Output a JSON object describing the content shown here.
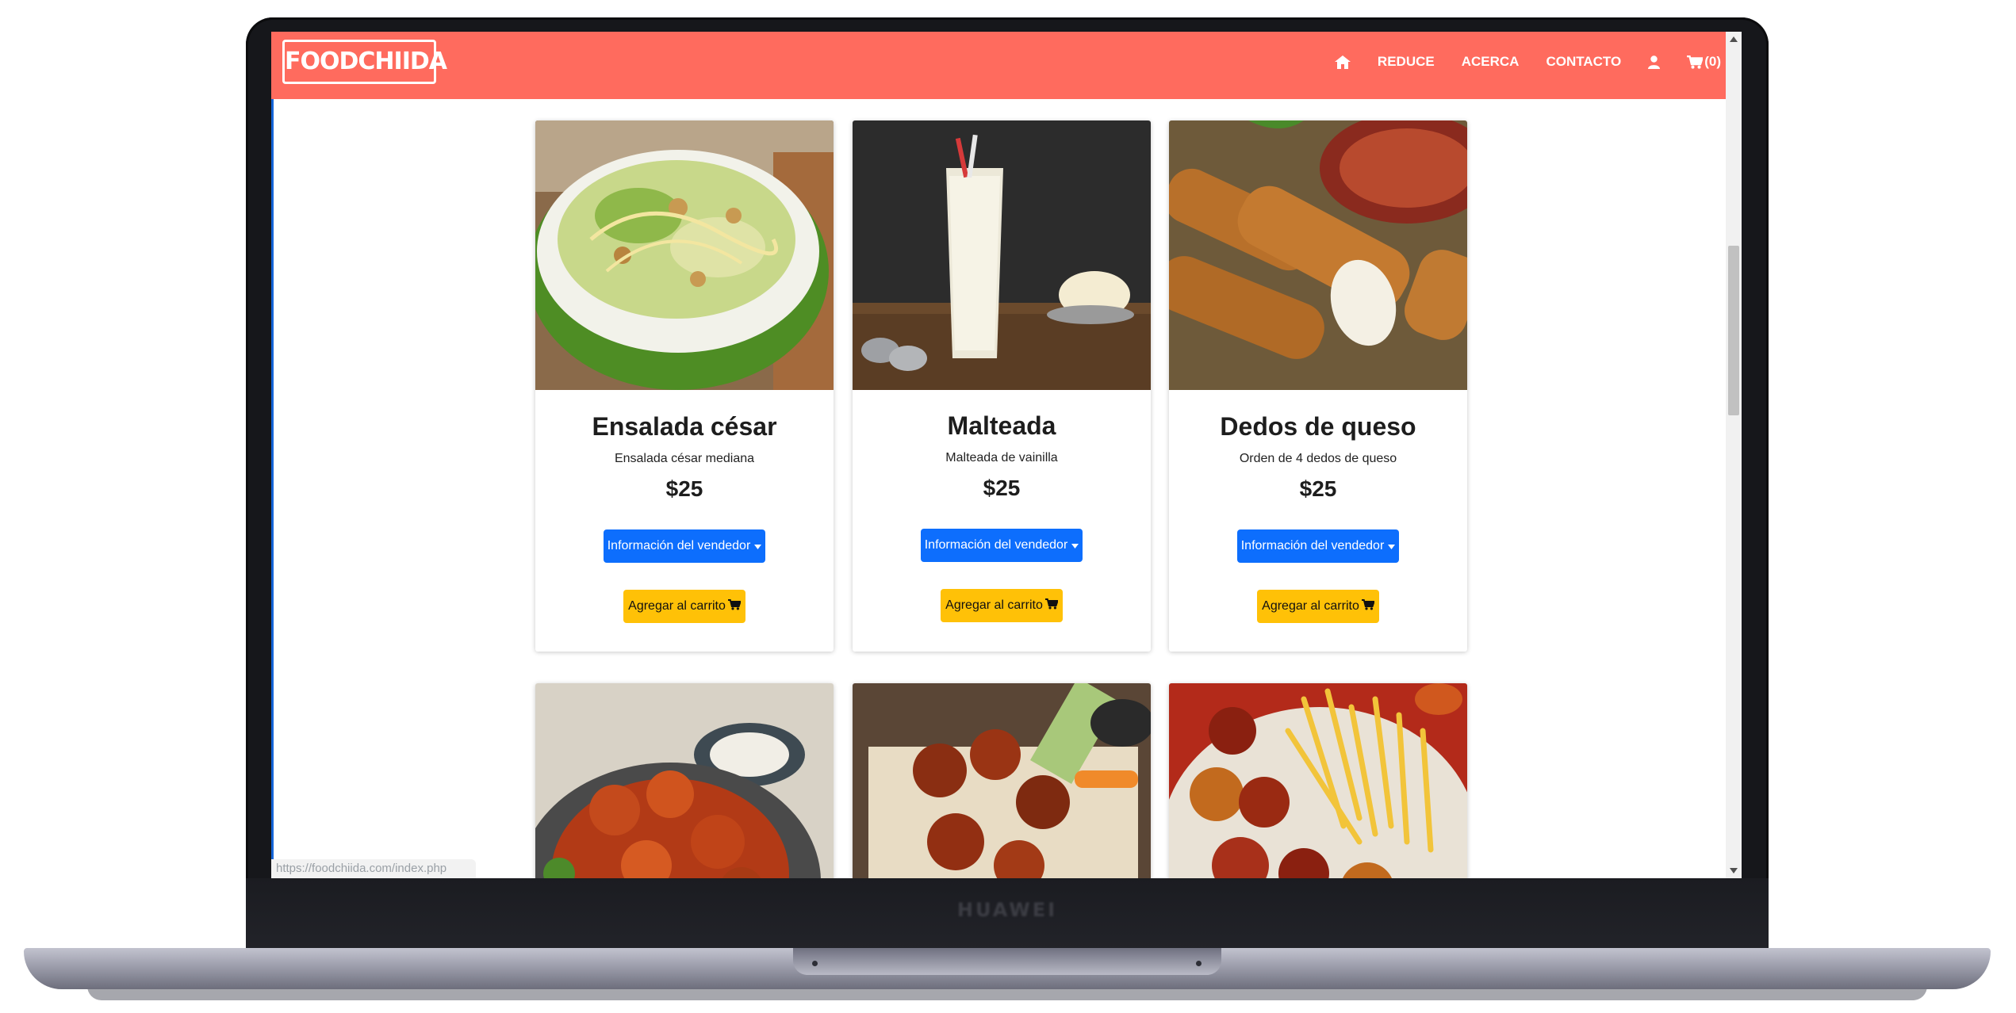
{
  "device": {
    "brand": "HUAWEI"
  },
  "app": {
    "logo_text": "FOODCHIIDA",
    "nav": {
      "home_icon": "home-icon",
      "items": [
        {
          "label": "REDUCE"
        },
        {
          "label": "ACERCA"
        },
        {
          "label": "CONTACTO"
        }
      ],
      "user_icon": "user-icon",
      "cart_icon": "cart-icon",
      "cart_count": "(0)"
    },
    "colors": {
      "navbar": "#ff6b5e",
      "vendor_button": "#0d6efd",
      "cart_button": "#ffc107"
    }
  },
  "products": [
    {
      "title": "Ensalada césar",
      "description": "Ensalada césar mediana",
      "price": "$25",
      "vendor_label": "Información del vendedor",
      "cart_label": "Agregar al carrito"
    },
    {
      "title": "Malteada",
      "description": "Malteada de vainilla",
      "price": "$25",
      "vendor_label": "Información del vendedor",
      "cart_label": "Agregar al carrito"
    },
    {
      "title": "Dedos de queso",
      "description": "Orden de 4 dedos de queso",
      "price": "$25",
      "vendor_label": "Información del vendedor",
      "cart_label": "Agregar al carrito"
    },
    {
      "image": "buffalo-wings-image"
    },
    {
      "image": "bbq-wings-image"
    },
    {
      "image": "wings-and-fries-image"
    }
  ],
  "status_bar": {
    "url": "https://foodchiida.com/index.php"
  }
}
